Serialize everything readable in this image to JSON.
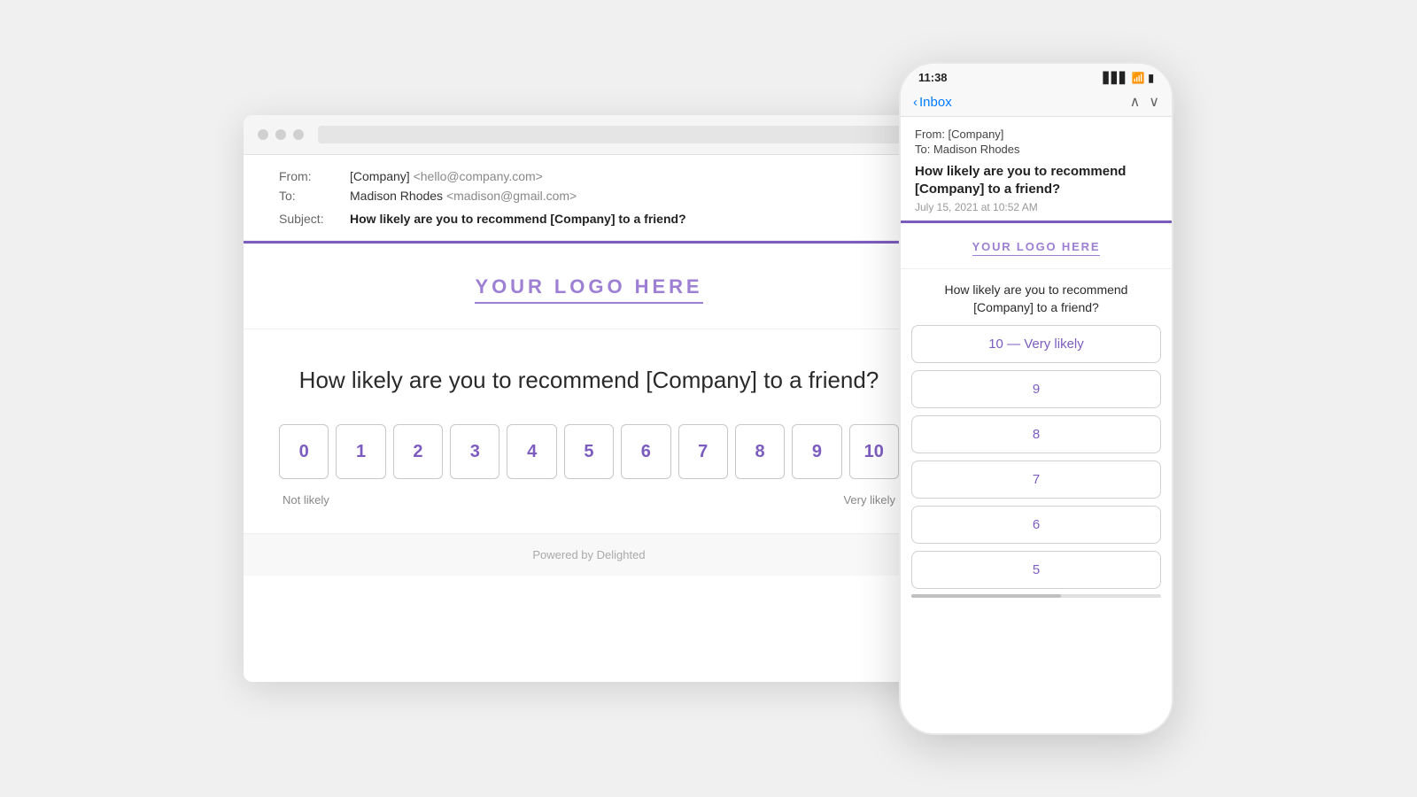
{
  "desktop": {
    "titlebar": {
      "dots": [
        "dot1",
        "dot2",
        "dot3"
      ]
    },
    "email": {
      "from_label": "From:",
      "from_value": "[Company]",
      "from_email": "<hello@company.com>",
      "to_label": "To:",
      "to_name": "Madison Rhodes",
      "to_email": "<madison@gmail.com>",
      "subject_label": "Subject:",
      "subject_value": "How likely are you to recommend [Company] to a friend?"
    },
    "logo": "YOUR LOGO HERE",
    "survey": {
      "question": "How likely are you to recommend [Company] to a friend?",
      "scale": [
        "0",
        "1",
        "2",
        "3",
        "4",
        "5",
        "6",
        "7",
        "8",
        "9",
        "10"
      ],
      "label_low": "Not likely",
      "label_high": "Very likely"
    },
    "footer": "Powered by Delighted"
  },
  "mobile": {
    "statusbar": {
      "time": "11:38",
      "signal": "▋▋▋",
      "wifi": "WiFi",
      "battery": "🔋"
    },
    "nav": {
      "back_label": "Inbox",
      "arrow_up": "∧",
      "arrow_down": "∨"
    },
    "email": {
      "from": "From: [Company]",
      "to": "To: Madison Rhodes",
      "subject": "How likely are you to recommend [Company] to a friend?",
      "date": "July 15, 2021 at 10:52 AM"
    },
    "logo": "YOUR LOGO HERE",
    "question": "How likely are you to recommend [Company] to a friend?",
    "options": [
      "10 — Very likely",
      "9",
      "8",
      "7",
      "6",
      "5"
    ]
  }
}
